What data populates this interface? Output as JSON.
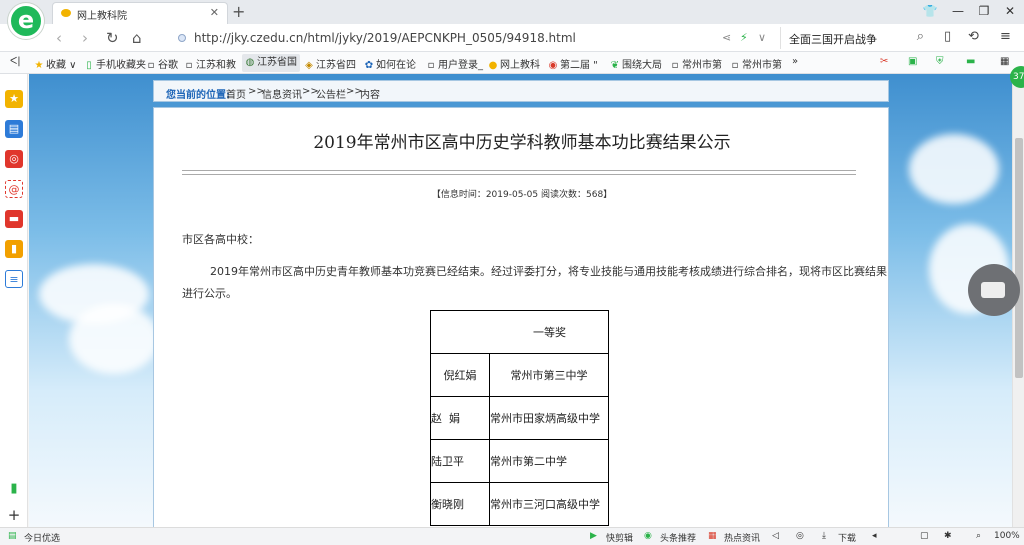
{
  "tab": {
    "title": "网上教科院",
    "close": "✕",
    "new": "+"
  },
  "window": {
    "min": "—",
    "max": "❐",
    "close": "✕",
    "skin": "👕"
  },
  "nav": {
    "back": "‹",
    "forward": "›",
    "refresh": "↻",
    "home": "⌂"
  },
  "address": {
    "url": "http://jky.czedu.cn/html/jyky/2019/AEPCNKPH_0505/94918.html",
    "share": "⋖",
    "bolt": "⚡",
    "drop": "∨"
  },
  "search": {
    "query": "全面三国开启战争",
    "icon": "⌕"
  },
  "toolbar": {
    "phone": "▯",
    "undo": "⟲",
    "menu": "≡"
  },
  "bookmarks": [
    "收藏",
    "手机收藏夹",
    "谷歌",
    "江苏和教",
    "江苏省国",
    "江苏省四",
    "如何在论",
    "用户登录_",
    "网上教科",
    "第二届 \"",
    "围绕大局",
    "常州市第",
    "常州市第",
    "»"
  ],
  "bookmarks_left": "ᐸ|",
  "page": {
    "breadcrumb_label": "您当前的位置:",
    "breadcrumbs": [
      "首页",
      ">>",
      "信息资讯",
      ">>",
      "公告栏",
      ">>",
      "内容"
    ],
    "title": "2019年常州市区高中历史学科教师基本功比赛结果公示",
    "info": "【信息时间：2019-05-05   阅读次数：568】",
    "salutation": "市区各高中校：",
    "body_line1": "2019年常州市区高中历史青年教师基本功竞赛已经结束。经过评委打分，将专业技能与通用技能考核成绩进行综合排名，现将市区比赛结果",
    "body_line2": "进行公示。",
    "table": {
      "header": "一等奖",
      "rows": [
        {
          "name": "倪红娟",
          "school": "常州市第三中学"
        },
        {
          "name": "赵  娟",
          "school": "常州市田家炳高级中学"
        },
        {
          "name": "陆卫平",
          "school": "常州市第二中学"
        },
        {
          "name": "衡晓刚",
          "school": "常州市三河口高级中学"
        }
      ]
    }
  },
  "badge": "37",
  "status": {
    "left": "今日优选",
    "items": [
      "快剪辑",
      "头条推荐",
      "热点资讯",
      "下载",
      "100%"
    ]
  },
  "sidebar_add": "+"
}
